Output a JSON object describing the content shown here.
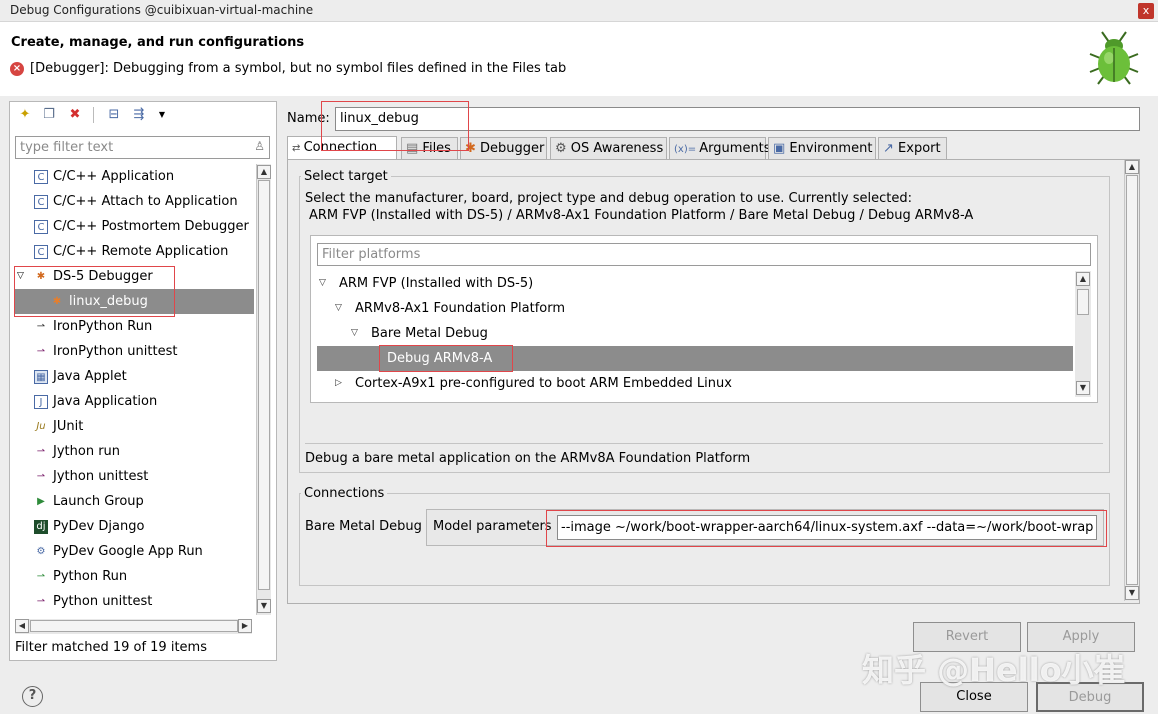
{
  "window": {
    "title": "Debug Configurations @cuibixuan-virtual-machine",
    "close_glyph": "x"
  },
  "header": {
    "title": "Create, manage, and run configurations",
    "error_message": "[Debugger]: Debugging from a symbol, but no symbol files defined in the Files tab"
  },
  "left": {
    "filter_placeholder": "type filter text",
    "items": [
      {
        "label": "C/C++ Application",
        "icon": "c-icon"
      },
      {
        "label": "C/C++ Attach to Application",
        "icon": "c-icon"
      },
      {
        "label": "C/C++ Postmortem Debugger",
        "icon": "c-icon"
      },
      {
        "label": "C/C++ Remote Application",
        "icon": "c-icon"
      },
      {
        "label": "DS-5 Debugger",
        "icon": "bug-icon"
      },
      {
        "label": "linux_debug",
        "icon": "bug-icon"
      },
      {
        "label": "IronPython Run",
        "icon": "python-run-icon"
      },
      {
        "label": "IronPython unittest",
        "icon": "python-test-icon"
      },
      {
        "label": "Java Applet",
        "icon": "applet-icon"
      },
      {
        "label": "Java Application",
        "icon": "java-icon"
      },
      {
        "label": "JUnit",
        "icon": "junit-icon"
      },
      {
        "label": "Jython run",
        "icon": "jython-run-icon"
      },
      {
        "label": "Jython unittest",
        "icon": "jython-test-icon"
      },
      {
        "label": "Launch Group",
        "icon": "launch-icon"
      },
      {
        "label": "PyDev Django",
        "icon": "django-icon"
      },
      {
        "label": "PyDev Google App Run",
        "icon": "google-app-icon"
      },
      {
        "label": "Python Run",
        "icon": "python-icon"
      },
      {
        "label": "Python unittest",
        "icon": "python-test-icon"
      }
    ],
    "status": "Filter matched 19 of 19 items"
  },
  "config": {
    "name_label": "Name:",
    "name_value": "linux_debug",
    "tabs": [
      "Connection",
      "Files",
      "Debugger",
      "OS Awareness",
      "Arguments",
      "Environment",
      "Export"
    ],
    "select_target_title": "Select target",
    "select_text": "Select the manufacturer, board, project type and debug operation to use. Currently selected:",
    "current_selection": "ARM FVP (Installed with DS-5) / ARMv8-Ax1 Foundation Platform / Bare Metal Debug / Debug ARMv8-A",
    "platform_filter_placeholder": "Filter platforms",
    "platforms": [
      "ARM FVP (Installed with DS-5)",
      "ARMv8-Ax1 Foundation Platform",
      "Bare Metal Debug",
      "Debug ARMv8-A",
      "Cortex-A9x1 pre-configured to boot ARM Embedded Linux"
    ],
    "description": "Debug a bare metal application on the ARMv8A Foundation Platform",
    "connections_title": "Connections",
    "bare_metal_label": "Bare Metal Debug",
    "model_params_label": "Model parameters",
    "model_params_value": "--image ~/work/boot-wrapper-aarch64/linux-system.axf --data=~/work/boot-wrap"
  },
  "buttons": {
    "revert": "Revert",
    "apply": "Apply",
    "close": "Close",
    "debug": "Debug"
  },
  "watermark": "知乎 @Hello小崔",
  "colors": {
    "selection": "#8c8c8c",
    "highlight_box": "#e0464a",
    "error": "#d64541"
  }
}
